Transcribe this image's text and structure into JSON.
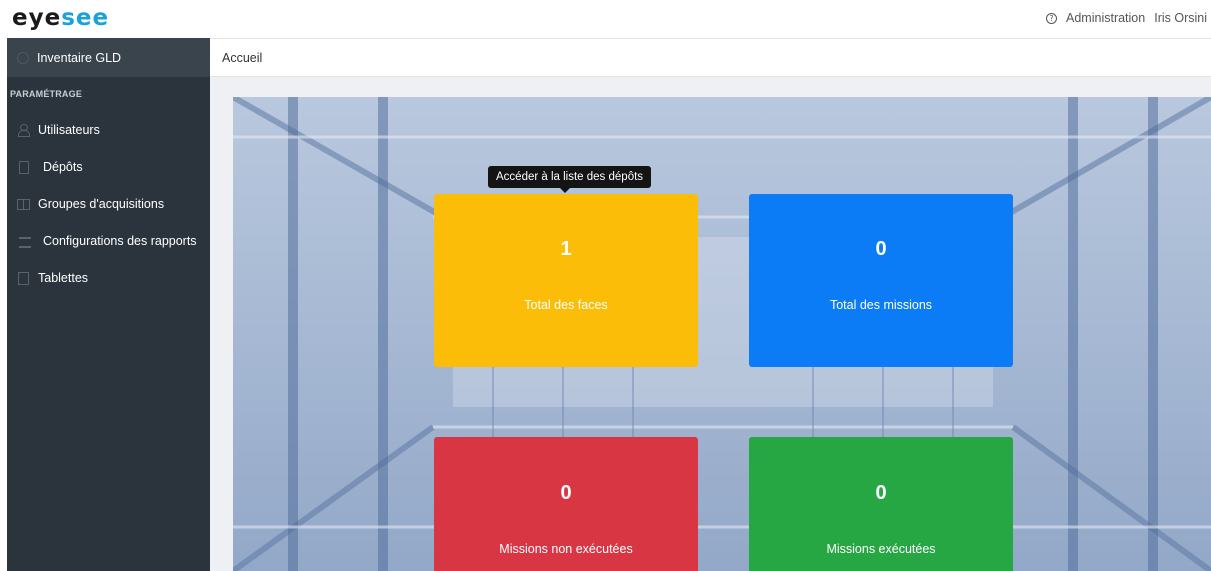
{
  "app": {
    "logo_part_a": "eye",
    "logo_part_b": "see"
  },
  "header": {
    "help_icon": "?",
    "admin_label": "Administration",
    "user_name": "Iris Orsini"
  },
  "sidebar": {
    "project": "Inventaire GLD",
    "section_title": "PARAMÉTRAGE",
    "items": [
      {
        "label": "Utilisateurs",
        "icon": "user-icon"
      },
      {
        "label": "Dépôts",
        "icon": "depot-icon"
      },
      {
        "label": "Groupes d'acquisitions",
        "icon": "group-icon"
      },
      {
        "label": "Configurations des rapports",
        "icon": "report-config-icon"
      },
      {
        "label": "Tablettes",
        "icon": "tablet-icon"
      }
    ]
  },
  "breadcrumb": "Accueil",
  "tooltip": "Accéder à la liste des dépôts",
  "cards": [
    {
      "value": "1",
      "label": "Total des faces",
      "color": "#fbbd08"
    },
    {
      "value": "0",
      "label": "Total des missions",
      "color": "#0b7cf6"
    },
    {
      "value": "0",
      "label": "Missions non exécutées",
      "color": "#d93644"
    },
    {
      "value": "0",
      "label": "Missions exécutées",
      "color": "#27a744"
    }
  ]
}
